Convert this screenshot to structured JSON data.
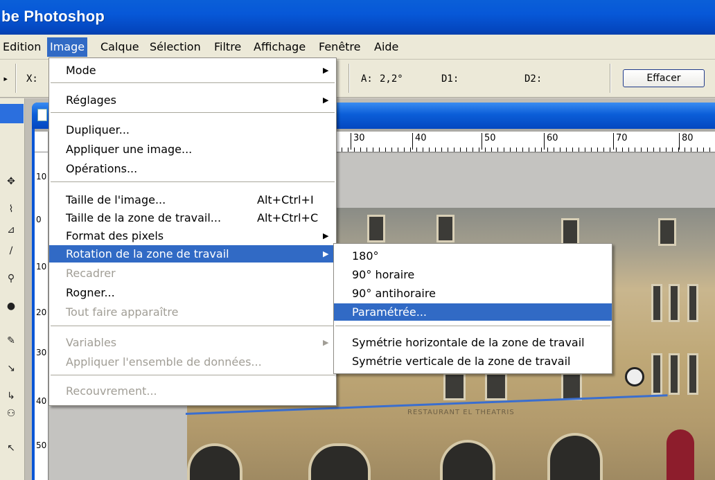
{
  "app": {
    "title": "be Photoshop"
  },
  "menubar": {
    "items": [
      {
        "label": "Edition"
      },
      {
        "label": "Image"
      },
      {
        "label": "Calque"
      },
      {
        "label": "Sélection"
      },
      {
        "label": "Filtre"
      },
      {
        "label": "Affichage"
      },
      {
        "label": "Fenêtre"
      },
      {
        "label": "Aide"
      }
    ],
    "active": "Image"
  },
  "options": {
    "x_label": "X:",
    "angle_label": "A:",
    "angle_value": "2,2°",
    "d1_label": "D1:",
    "d2_label": "D2:",
    "clear_button": "Effacer"
  },
  "rulers": {
    "top_ticks": [
      "30",
      "40",
      "50",
      "60",
      "70",
      "80"
    ],
    "left_ticks": [
      "10",
      "0",
      "10",
      "20",
      "30",
      "40",
      "50"
    ]
  },
  "photo": {
    "sign_text": "RESTAURANT  EL THEATRIS"
  },
  "image_menu": {
    "items": [
      {
        "label": "Mode",
        "arrow": "▶",
        "disabled": false
      },
      {
        "label": "Réglages",
        "arrow": "▶",
        "disabled": false
      },
      {
        "label": "Dupliquer...",
        "disabled": false
      },
      {
        "label": "Appliquer une image...",
        "disabled": false
      },
      {
        "label": "Opérations...",
        "disabled": false
      },
      {
        "label": "Taille de l'image...",
        "shortcut": "Alt+Ctrl+I",
        "disabled": false
      },
      {
        "label": "Taille de la zone de travail...",
        "shortcut": "Alt+Ctrl+C",
        "disabled": false
      },
      {
        "label": "Format des pixels",
        "arrow": "▶",
        "disabled": false
      },
      {
        "label": "Rotation de la zone de travail",
        "arrow": "▶",
        "disabled": false,
        "highlighted": true
      },
      {
        "label": "Recadrer",
        "disabled": true
      },
      {
        "label": "Rogner...",
        "disabled": false
      },
      {
        "label": "Tout faire apparaître",
        "disabled": true
      },
      {
        "label": "Variables",
        "arrow": "▶",
        "disabled": true
      },
      {
        "label": "Appliquer l'ensemble de données...",
        "disabled": true
      },
      {
        "label": "Recouvrement...",
        "disabled": true
      }
    ]
  },
  "submenu": {
    "items": [
      {
        "label": "180°"
      },
      {
        "label": "90° horaire"
      },
      {
        "label": "90° antihoraire"
      },
      {
        "label": "Paramétrée...",
        "highlighted": true
      },
      {
        "label": "Symétrie horizontale de la zone de travail"
      },
      {
        "label": "Symétrie verticale de la zone de travail"
      }
    ]
  },
  "colors": {
    "titlebar": "#0758d8",
    "menu_highlight": "#316ac5",
    "menubar_bg": "#ece9d8",
    "disabled_text": "#a19e96"
  }
}
